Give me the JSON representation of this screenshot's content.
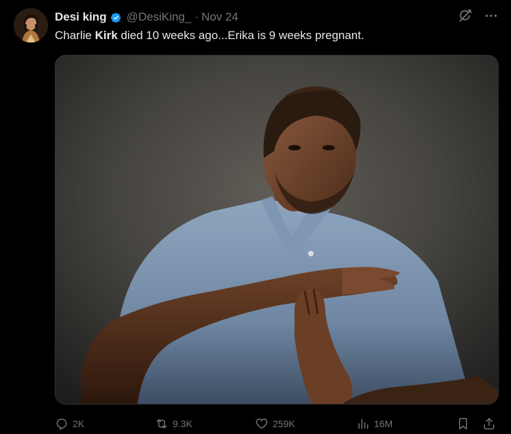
{
  "tweet": {
    "display_name": "Desi king",
    "verified": true,
    "handle": "@DesiKing_",
    "separator": "·",
    "date": "Nov 24",
    "text_part1": "Charlie ",
    "text_bold": "Kirk",
    "text_part2": " died 10 weeks ago...Erika is 9 weeks pregnant.",
    "icons": {
      "grok": "grok-icon",
      "more": "more-icon",
      "verified": "verified-badge-icon"
    }
  },
  "metrics": {
    "replies": "2K",
    "reposts": "9.3K",
    "likes": "259K",
    "views": "16M"
  },
  "colors": {
    "background": "#000000",
    "text": "#e7e9ea",
    "secondary": "#71767b",
    "verified": "#1d9bf0",
    "border": "#2f3336"
  }
}
